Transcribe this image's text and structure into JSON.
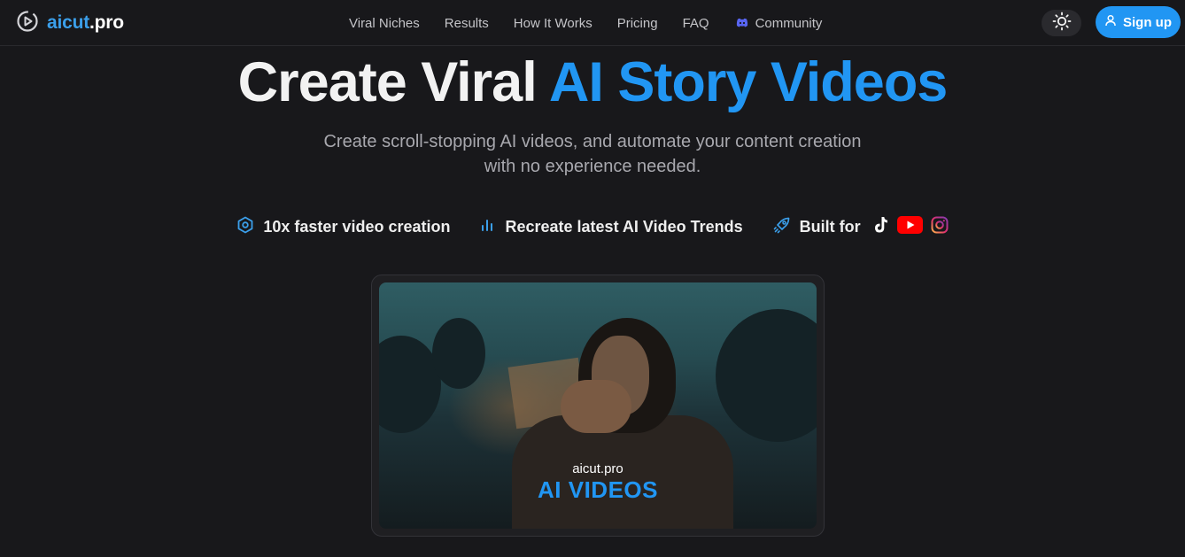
{
  "brand": {
    "name_accent": "aicut",
    "name_rest": ".pro"
  },
  "nav": {
    "links": [
      "Viral Niches",
      "Results",
      "How It Works",
      "Pricing",
      "FAQ",
      "Community"
    ]
  },
  "header": {
    "signup_label": "Sign up"
  },
  "hero": {
    "title_white": "Create Viral",
    "title_blue": "AI Story Videos",
    "subtitle_line1": "Create scroll-stopping AI videos, and automate your content creation",
    "subtitle_line2": "with no experience needed."
  },
  "features": [
    {
      "icon": "hexagon-icon",
      "label": "10x faster video creation"
    },
    {
      "icon": "bar-chart-icon",
      "label": "Recreate latest AI Video Trends"
    },
    {
      "icon": "rocket-icon",
      "label": "Built for"
    }
  ],
  "social_icons": [
    "tiktok-icon",
    "youtube-icon",
    "instagram-icon"
  ],
  "video": {
    "overlay_small": "aicut.pro",
    "overlay_big": "AI VIDEOS"
  },
  "colors": {
    "background": "#18181b",
    "accent": "#2196f3",
    "muted_text": "#a8a8ae"
  }
}
